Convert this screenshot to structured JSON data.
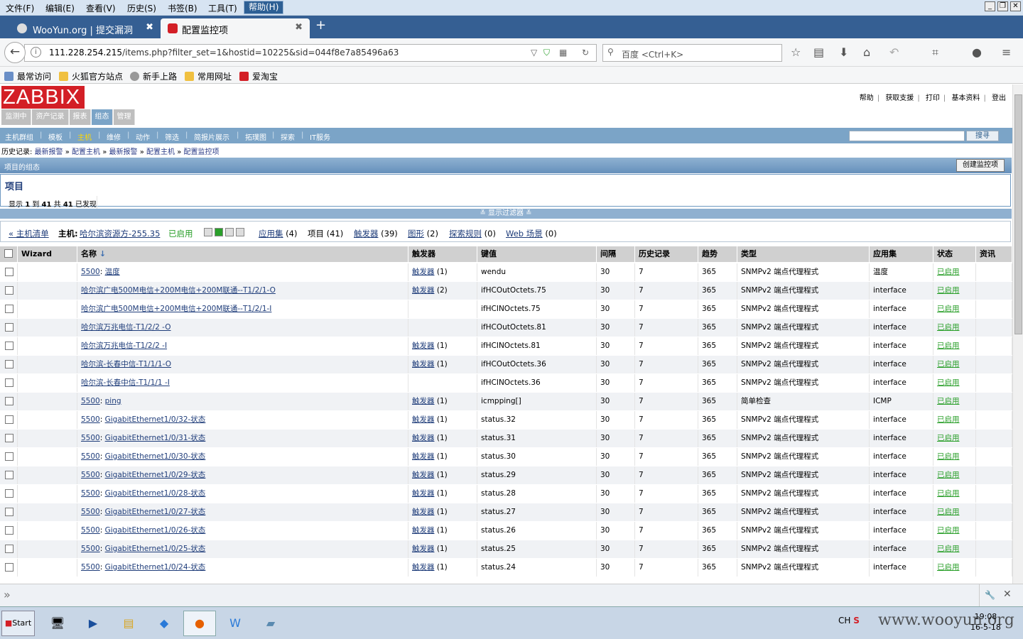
{
  "menubar": {
    "items": [
      "文件(F)",
      "编辑(E)",
      "查看(V)",
      "历史(S)",
      "书签(B)",
      "工具(T)",
      "帮助(H)"
    ]
  },
  "tabs": [
    {
      "label": "WooYun.org | 提交漏洞",
      "close": "✖"
    },
    {
      "label": "配置监控项",
      "close": "✖"
    }
  ],
  "nav": {
    "url_host": "111.228.254.215",
    "url_path": "/items.php?filter_set=1&hostid=10225&sid=044f8e7a85496a63",
    "search_placeholder": "百度 <Ctrl+K>"
  },
  "bookmarks": [
    "最常访问",
    "火狐官方站点",
    "新手上路",
    "常用网址",
    "爱淘宝"
  ],
  "zabbix": {
    "logo": "ZABBIX",
    "toplinks": [
      "帮助",
      "获取支援",
      "打印",
      "基本资料",
      "登出"
    ],
    "mainmenu": [
      "监测中",
      "资产记录",
      "报表",
      "组态",
      "管理"
    ],
    "submenu": [
      "主机群组",
      "模板",
      "主机",
      "维修",
      "动作",
      "筛选",
      "简报片展示",
      "拓璞图",
      "探索",
      "IT服务"
    ],
    "search_button": "搜寻",
    "history_label": "历史记录:",
    "history": [
      "最新报警",
      "配置主机",
      "最新报警",
      "配置主机",
      "配置监控项"
    ],
    "header_title": "项目的组态",
    "create_button": "创建监控项",
    "items_heading": "项目",
    "count_text": {
      "a": "显示",
      "b": "1",
      "c": "到",
      "d": "41",
      "e": "共",
      "f": "41",
      "g": "已发现"
    },
    "filter_toggle": "≚ 显示过滤器 ≚",
    "hostbar": {
      "host_list": "« 主机清单",
      "host_label": "主机:",
      "host_name": "哈尔滨资源方-255.35",
      "status": "已启用",
      "applications": "应用集",
      "applications_count": "(4)",
      "items": "项目",
      "items_count": "(41)",
      "triggers": "触发器",
      "triggers_count": "(39)",
      "graphs": "图形",
      "graphs_count": "(2)",
      "discovery": "探索规则",
      "discovery_count": "(0)",
      "web": "Web 场景",
      "web_count": "(0)"
    },
    "columns": [
      "Wizard",
      "名称",
      "触发器",
      "键值",
      "间隔",
      "历史记录",
      "趋势",
      "类型",
      "应用集",
      "状态",
      "资讯"
    ],
    "rows": [
      {
        "prefix": "5500",
        "name": "温度",
        "trig": "触发器",
        "tc": "(1)",
        "key": "wendu",
        "interval": "30",
        "history": "7",
        "trends": "365",
        "type": "SNMPv2 端点代理程式",
        "app": "温度",
        "status": "已启用"
      },
      {
        "prefix": "",
        "name": "哈尔滨广电500M电信+200M电信+200M联通--T1/2/1-O",
        "trig": "触发器",
        "tc": "(2)",
        "key": "ifHCOutOctets.75",
        "interval": "30",
        "history": "7",
        "trends": "365",
        "type": "SNMPv2 端点代理程式",
        "app": "interface",
        "status": "已启用"
      },
      {
        "prefix": "",
        "name": "哈尔滨广电500M电信+200M电信+200M联通--T1/2/1-I",
        "trig": "",
        "tc": "",
        "key": "ifHCINOctets.75",
        "interval": "30",
        "history": "7",
        "trends": "365",
        "type": "SNMPv2 端点代理程式",
        "app": "interface",
        "status": "已启用"
      },
      {
        "prefix": "",
        "name": "哈尔滨万兆电信-T1/2/2 -O",
        "trig": "",
        "tc": "",
        "key": "ifHCOutOctets.81",
        "interval": "30",
        "history": "7",
        "trends": "365",
        "type": "SNMPv2 端点代理程式",
        "app": "interface",
        "status": "已启用"
      },
      {
        "prefix": "",
        "name": "哈尔滨万兆电信-T1/2/2 -I",
        "trig": "触发器",
        "tc": "(1)",
        "key": "ifHCINOctets.81",
        "interval": "30",
        "history": "7",
        "trends": "365",
        "type": "SNMPv2 端点代理程式",
        "app": "interface",
        "status": "已启用"
      },
      {
        "prefix": "",
        "name": "哈尔滨-长春中信-T1/1/1-O",
        "trig": "触发器",
        "tc": "(1)",
        "key": "ifHCOutOctets.36",
        "interval": "30",
        "history": "7",
        "trends": "365",
        "type": "SNMPv2 端点代理程式",
        "app": "interface",
        "status": "已启用"
      },
      {
        "prefix": "",
        "name": "哈尔滨-长春中信-T1/1/1 -I",
        "trig": "",
        "tc": "",
        "key": "ifHCINOctets.36",
        "interval": "30",
        "history": "7",
        "trends": "365",
        "type": "SNMPv2 端点代理程式",
        "app": "interface",
        "status": "已启用"
      },
      {
        "prefix": "5500",
        "name": "ping",
        "trig": "触发器",
        "tc": "(1)",
        "key": "icmpping[]",
        "interval": "30",
        "history": "7",
        "trends": "365",
        "type": "简单检查",
        "app": "ICMP",
        "status": "已启用"
      },
      {
        "prefix": "5500",
        "name": "GigabitEthernet1/0/32-状态",
        "trig": "触发器",
        "tc": "(1)",
        "key": "status.32",
        "interval": "30",
        "history": "7",
        "trends": "365",
        "type": "SNMPv2 端点代理程式",
        "app": "interface",
        "status": "已启用"
      },
      {
        "prefix": "5500",
        "name": "GigabitEthernet1/0/31-状态",
        "trig": "触发器",
        "tc": "(1)",
        "key": "status.31",
        "interval": "30",
        "history": "7",
        "trends": "365",
        "type": "SNMPv2 端点代理程式",
        "app": "interface",
        "status": "已启用"
      },
      {
        "prefix": "5500",
        "name": "GigabitEthernet1/0/30-状态",
        "trig": "触发器",
        "tc": "(1)",
        "key": "status.30",
        "interval": "30",
        "history": "7",
        "trends": "365",
        "type": "SNMPv2 端点代理程式",
        "app": "interface",
        "status": "已启用"
      },
      {
        "prefix": "5500",
        "name": "GigabitEthernet1/0/29-状态",
        "trig": "触发器",
        "tc": "(1)",
        "key": "status.29",
        "interval": "30",
        "history": "7",
        "trends": "365",
        "type": "SNMPv2 端点代理程式",
        "app": "interface",
        "status": "已启用"
      },
      {
        "prefix": "5500",
        "name": "GigabitEthernet1/0/28-状态",
        "trig": "触发器",
        "tc": "(1)",
        "key": "status.28",
        "interval": "30",
        "history": "7",
        "trends": "365",
        "type": "SNMPv2 端点代理程式",
        "app": "interface",
        "status": "已启用"
      },
      {
        "prefix": "5500",
        "name": "GigabitEthernet1/0/27-状态",
        "trig": "触发器",
        "tc": "(1)",
        "key": "status.27",
        "interval": "30",
        "history": "7",
        "trends": "365",
        "type": "SNMPv2 端点代理程式",
        "app": "interface",
        "status": "已启用"
      },
      {
        "prefix": "5500",
        "name": "GigabitEthernet1/0/26-状态",
        "trig": "触发器",
        "tc": "(1)",
        "key": "status.26",
        "interval": "30",
        "history": "7",
        "trends": "365",
        "type": "SNMPv2 端点代理程式",
        "app": "interface",
        "status": "已启用"
      },
      {
        "prefix": "5500",
        "name": "GigabitEthernet1/0/25-状态",
        "trig": "触发器",
        "tc": "(1)",
        "key": "status.25",
        "interval": "30",
        "history": "7",
        "trends": "365",
        "type": "SNMPv2 端点代理程式",
        "app": "interface",
        "status": "已启用"
      },
      {
        "prefix": "5500",
        "name": "GigabitEthernet1/0/24-状态",
        "trig": "触发器",
        "tc": "(1)",
        "key": "status.24",
        "interval": "30",
        "history": "7",
        "trends": "365",
        "type": "SNMPv2 端点代理程式",
        "app": "interface",
        "status": "已启用"
      }
    ]
  },
  "taskbar": {
    "start": "Start",
    "lang": "CH",
    "time": "19:08",
    "date": "16-5-18",
    "watermark": "www.wooyun.org"
  },
  "colors": {
    "zabbix_red": "#d31f26",
    "menu_blue": "#7ba4c7",
    "enabled_green": "#2a9f2a",
    "link_blue": "#1f3d7a"
  }
}
